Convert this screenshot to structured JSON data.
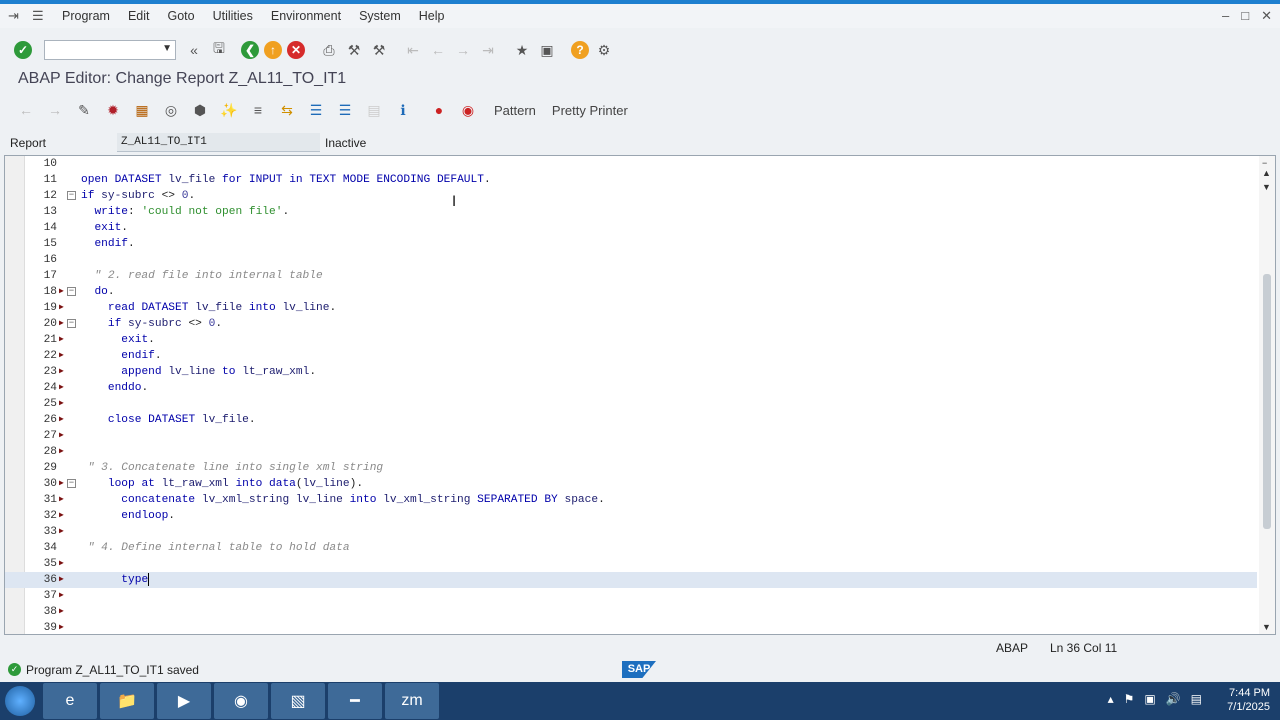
{
  "menubar": {
    "items": [
      "Program",
      "Edit",
      "Goto",
      "Utilities",
      "Environment",
      "System",
      "Help"
    ]
  },
  "window_title": "ABAP Editor: Change Report Z_AL11_TO_IT1",
  "toolbar2": {
    "pattern_label": "Pattern",
    "pretty_printer_label": "Pretty Printer"
  },
  "fields": {
    "report_label": "Report",
    "report_value": "Z_AL11_TO_IT1",
    "status": "Inactive"
  },
  "editor": {
    "lines": [
      {
        "n": "10",
        "html": ""
      },
      {
        "n": "11",
        "html": "<span class='kw'>open</span> <span class='kw'>DATASET</span> <span class='plain'>lv_file</span> <span class='kw'>for</span> <span class='kw'>INPUT</span> <span class='kw'>in</span> <span class='kw'>TEXT</span> <span class='kw'>MODE</span> <span class='kw'>ENCODING</span> <span class='kw'>DEFAULT</span>."
      },
      {
        "n": "12",
        "html": "<span class='kw'>if</span> <span class='plain'>sy-subrc</span> &lt;&gt; <span class='num'>0</span>."
      },
      {
        "n": "13",
        "html": "  <span class='kw'>write</span>: <span class='str'>'could not open file'</span>."
      },
      {
        "n": "14",
        "html": "  <span class='kw'>exit</span>."
      },
      {
        "n": "15",
        "html": "  <span class='kw'>endif</span>."
      },
      {
        "n": "16",
        "html": ""
      },
      {
        "n": "17",
        "html": "  <span class='cmt'>\" 2. read file into internal table</span>"
      },
      {
        "n": "18",
        "html": "  <span class='kw'>do</span>."
      },
      {
        "n": "19",
        "html": "    <span class='kw'>read</span> <span class='kw'>DATASET</span> <span class='plain'>lv_file</span> <span class='kw'>into</span> <span class='plain'>lv_line</span>."
      },
      {
        "n": "20",
        "html": "    <span class='kw'>if</span> <span class='plain'>sy-subrc</span> &lt;&gt; <span class='num'>0</span>."
      },
      {
        "n": "21",
        "html": "      <span class='kw'>exit</span>."
      },
      {
        "n": "22",
        "html": "      <span class='kw'>endif</span>."
      },
      {
        "n": "23",
        "html": "      <span class='kw'>append</span> <span class='plain'>lv_line</span> <span class='kw'>to</span> <span class='plain'>lt_raw_xml</span>."
      },
      {
        "n": "24",
        "html": "    <span class='kw'>enddo</span>."
      },
      {
        "n": "25",
        "html": ""
      },
      {
        "n": "26",
        "html": "    <span class='kw'>close</span> <span class='kw'>DATASET</span> <span class='plain'>lv_file</span>."
      },
      {
        "n": "27",
        "html": ""
      },
      {
        "n": "28",
        "html": ""
      },
      {
        "n": "29",
        "html": " <span class='cmt'>\" 3. Concatenate line into single xml string</span>"
      },
      {
        "n": "30",
        "html": "    <span class='kw'>loop</span> <span class='kw'>at</span> <span class='plain'>lt_raw_xml</span> <span class='kw'>into</span> <span class='kw'>data</span>(<span class='plain'>lv_line</span>)."
      },
      {
        "n": "31",
        "html": "      <span class='kw'>concatenate</span> <span class='plain'>lv_xml_string</span> <span class='plain'>lv_line</span> <span class='kw'>into</span> <span class='plain'>lv_xml_string</span> <span class='kw'>SEPARATED</span> <span class='kw'>BY</span> <span class='plain'>space</span>."
      },
      {
        "n": "32",
        "html": "      <span class='kw'>endloop</span>."
      },
      {
        "n": "33",
        "html": ""
      },
      {
        "n": "34",
        "html": " <span class='cmt'>\" 4. Define internal table to hold data</span>"
      },
      {
        "n": "35",
        "html": ""
      },
      {
        "n": "36",
        "html": "      <span class='kw'>type</span><span class='caret'></span>"
      },
      {
        "n": "37",
        "html": ""
      },
      {
        "n": "38",
        "html": ""
      },
      {
        "n": "39",
        "html": ""
      }
    ],
    "current_line": "36"
  },
  "editor_status": {
    "language": "ABAP",
    "position": "Ln  36 Col  11"
  },
  "statusbar": {
    "message": "Program Z_AL11_TO_IT1 saved"
  },
  "taskbar": {
    "zoom_label": "zm",
    "time": "7:44 PM",
    "date": "7/1/2025"
  },
  "colors": {
    "keyword": "#0000aa",
    "string": "#2f8f2f",
    "comment": "#8a8a8a",
    "current_line": "#dde6f2"
  }
}
